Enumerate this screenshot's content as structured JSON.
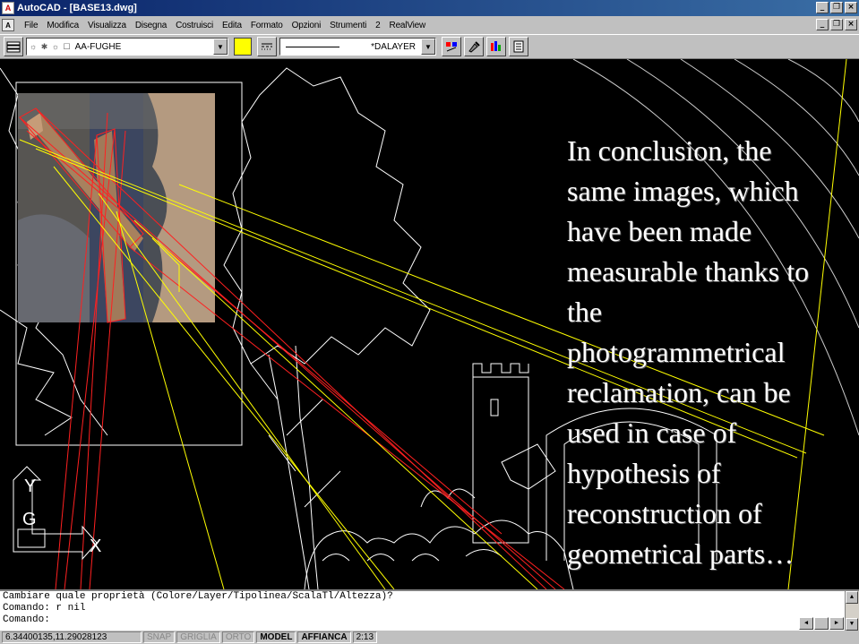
{
  "window": {
    "title": "AutoCAD - [BASE13.dwg]",
    "app_icon": "A"
  },
  "menu": {
    "doc_icon": "A",
    "items": [
      "File",
      "Modifica",
      "Visualizza",
      "Disegna",
      "Costruisci",
      "Edita",
      "Formato",
      "Opzioni",
      "Strumenti",
      "2",
      "RealView"
    ]
  },
  "toolbar": {
    "layer_name": "AA-FUGHE",
    "layer_icons": "☼ ✱ ☼ ☐",
    "current_color": "#ffff00",
    "linetype_label": "*DALAYER",
    "arrow": "▼"
  },
  "icons": {
    "minimize": "_",
    "restore": "❐",
    "close": "×"
  },
  "slide": {
    "text": "In conclusion, the\nsame images, which\nhave been made\nmeasurable thanks to\nthe\nphotogrammetrical\nreclamation, can be\nused in case of\nhypothesis of\nreconstruction of\ngeometrical parts…"
  },
  "ucs": {
    "y_label": "Y",
    "grid_label": "G",
    "x_label": "X"
  },
  "command": {
    "lines": [
      "Cambiare quale proprietà (Colore/Layer/Tipolinea/ScalaTl/Altezza)?",
      "Comando: r nil",
      "Comando:"
    ]
  },
  "status": {
    "coords": "6.34400135,11.29028123",
    "snap": "SNAP",
    "grid": "GRIGLIA",
    "ortho": "ORTO",
    "model": "MODEL",
    "tile": "AFFIANCA",
    "time": "2:13"
  },
  "colors": {
    "title_bar": "#0a246a",
    "canvas_bg": "#000000",
    "construction_red": "#ff2020",
    "construction_yellow": "#ffff00",
    "drawing_white": "#ffffff"
  }
}
